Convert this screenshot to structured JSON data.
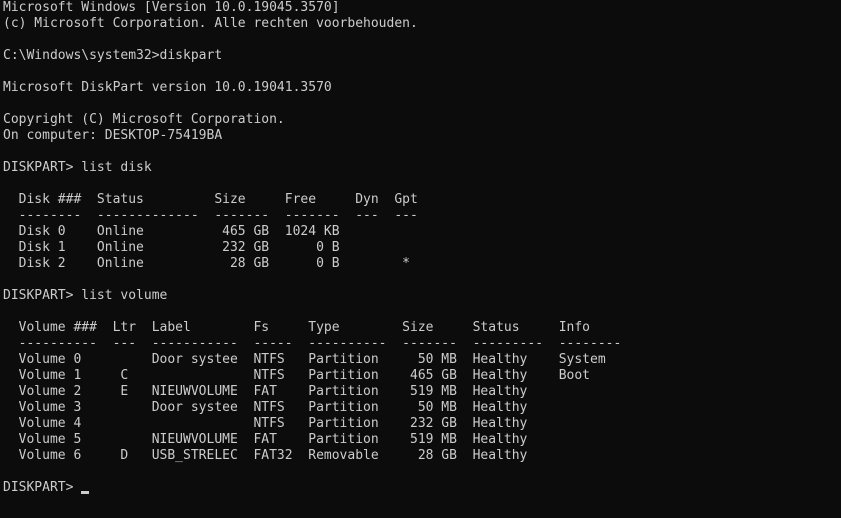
{
  "console": {
    "lines": [
      "Microsoft Windows [Version 10.0.19045.3570]",
      "(c) Microsoft Corporation. Alle rechten voorbehouden.",
      "",
      "C:\\Windows\\system32>diskpart",
      "",
      "Microsoft DiskPart version 10.0.19041.3570",
      "",
      "Copyright (C) Microsoft Corporation.",
      "On computer: DESKTOP-75419BA",
      "",
      "DISKPART> list disk",
      "",
      "  Disk ###  Status         Size     Free     Dyn  Gpt",
      "  --------  -------------  -------  -------  ---  ---",
      "  Disk 0    Online          465 GB  1024 KB",
      "  Disk 1    Online          232 GB      0 B",
      "  Disk 2    Online           28 GB      0 B        *",
      "",
      "DISKPART> list volume",
      "",
      "  Volume ###  Ltr  Label        Fs     Type        Size     Status     Info",
      "  ----------  ---  -----------  -----  ----------  -------  ---------  --------",
      "  Volume 0         Door systee  NTFS   Partition     50 MB  Healthy    System",
      "  Volume 1     C                NTFS   Partition    465 GB  Healthy    Boot",
      "  Volume 2     E   NIEUWVOLUME  FAT    Partition    519 MB  Healthy",
      "  Volume 3         Door systee  NTFS   Partition     50 MB  Healthy",
      "  Volume 4                      NTFS   Partition    232 GB  Healthy",
      "  Volume 5         NIEUWVOLUME  FAT    Partition    519 MB  Healthy",
      "  Volume 6     D   USB_STRELEC  FAT32  Removable     28 GB  Healthy",
      ""
    ],
    "prompt": "DISKPART>"
  }
}
